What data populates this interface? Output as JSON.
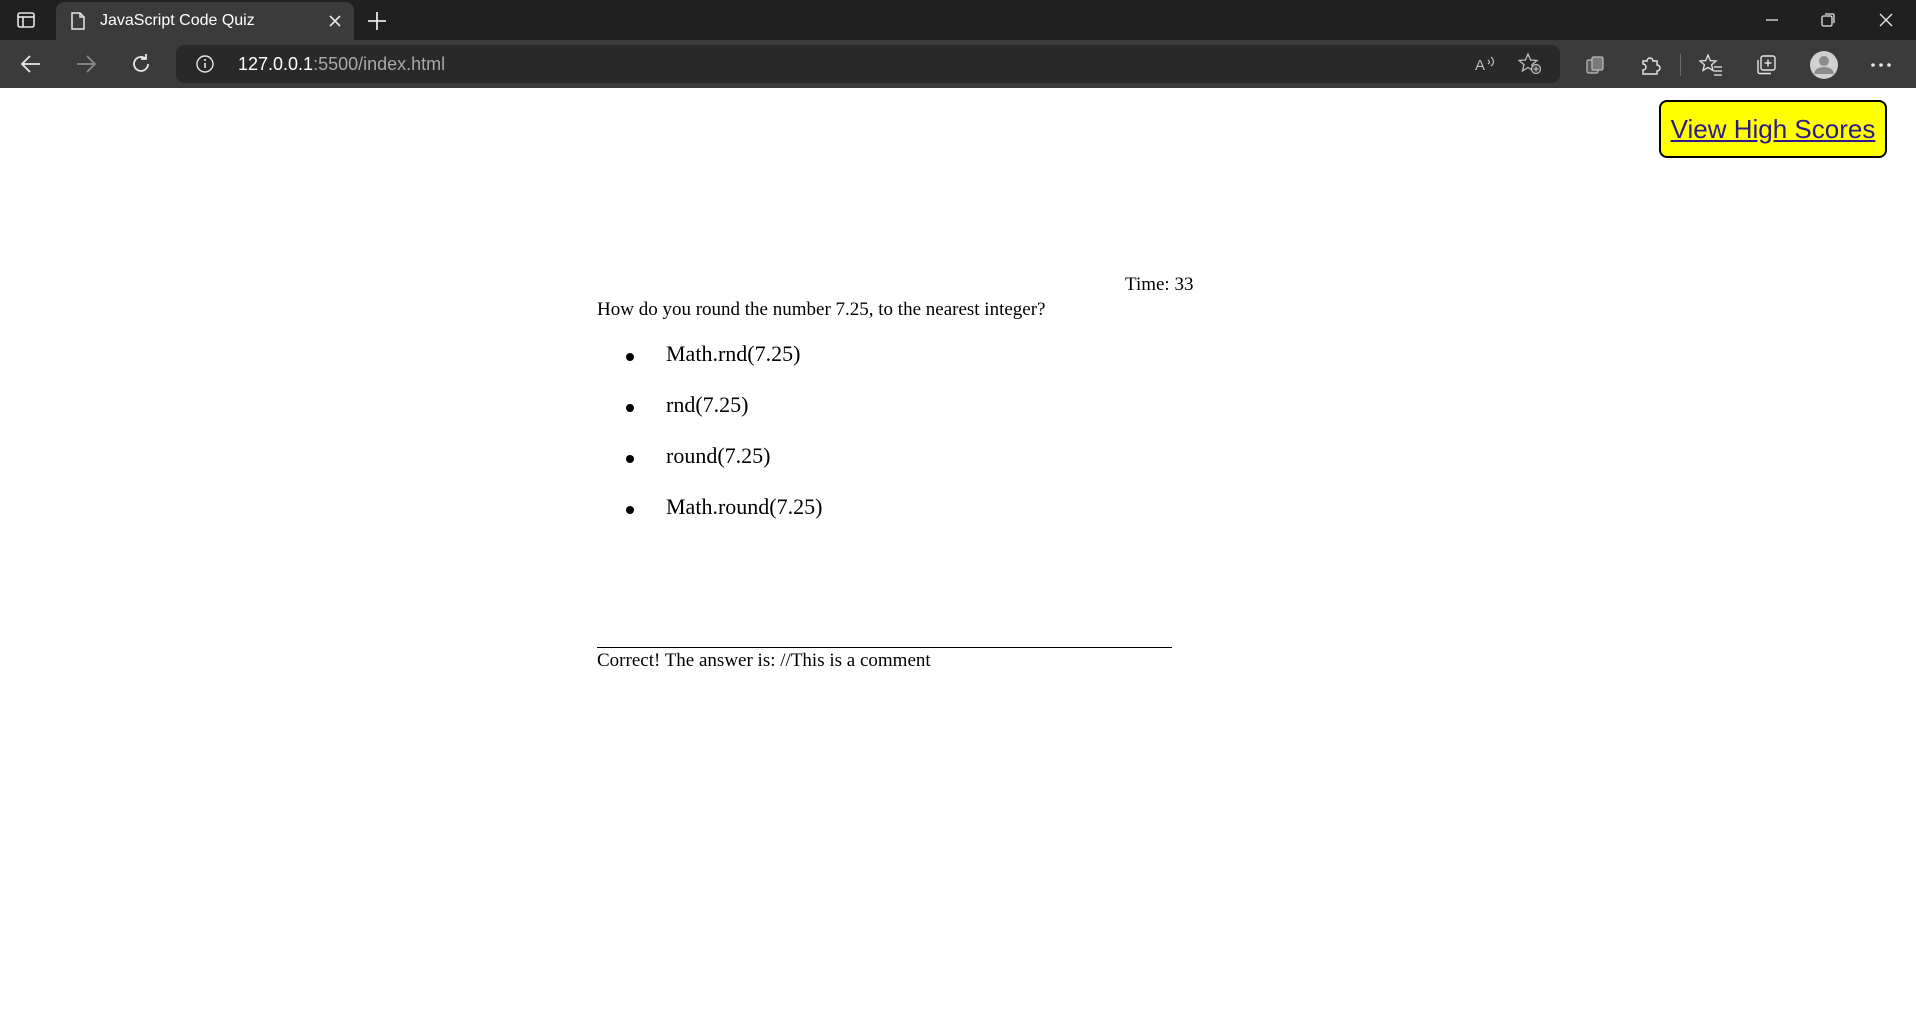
{
  "browser": {
    "tab_title": "JavaScript Code Quiz",
    "url_host": "127.0.0.1",
    "url_path": ":5500/index.html",
    "icons": {
      "sidebar": "sidebar-toggle-icon",
      "favicon": "page-icon",
      "close": "close-icon",
      "new_tab": "plus-icon",
      "back": "back-arrow-icon",
      "forward": "forward-arrow-icon",
      "reload": "reload-icon",
      "info": "info-icon",
      "read_aloud": "read-aloud-icon",
      "add_favorite": "add-favorite-icon",
      "extensions_workspaces": "workspaces-icon",
      "extensions": "puzzle-icon",
      "favorites": "favorites-icon",
      "collections": "collections-icon",
      "profile": "avatar-icon",
      "more": "more-icon"
    },
    "colors": {
      "tabstrip_bg": "#202020",
      "toolbar_bg": "#3b3b3b",
      "omnibox_bg": "#292929"
    }
  },
  "page": {
    "highscores_label": "View High Scores",
    "highscores_color": "#ffff00",
    "timer_text": "Time: 33",
    "question": "How do you round the number 7.25, to the nearest integer?",
    "choices": [
      "Math.rnd(7.25)",
      "rnd(7.25)",
      "round(7.25)",
      "Math.round(7.25)"
    ],
    "result_text": "Correct! The answer is: //This is a comment"
  }
}
